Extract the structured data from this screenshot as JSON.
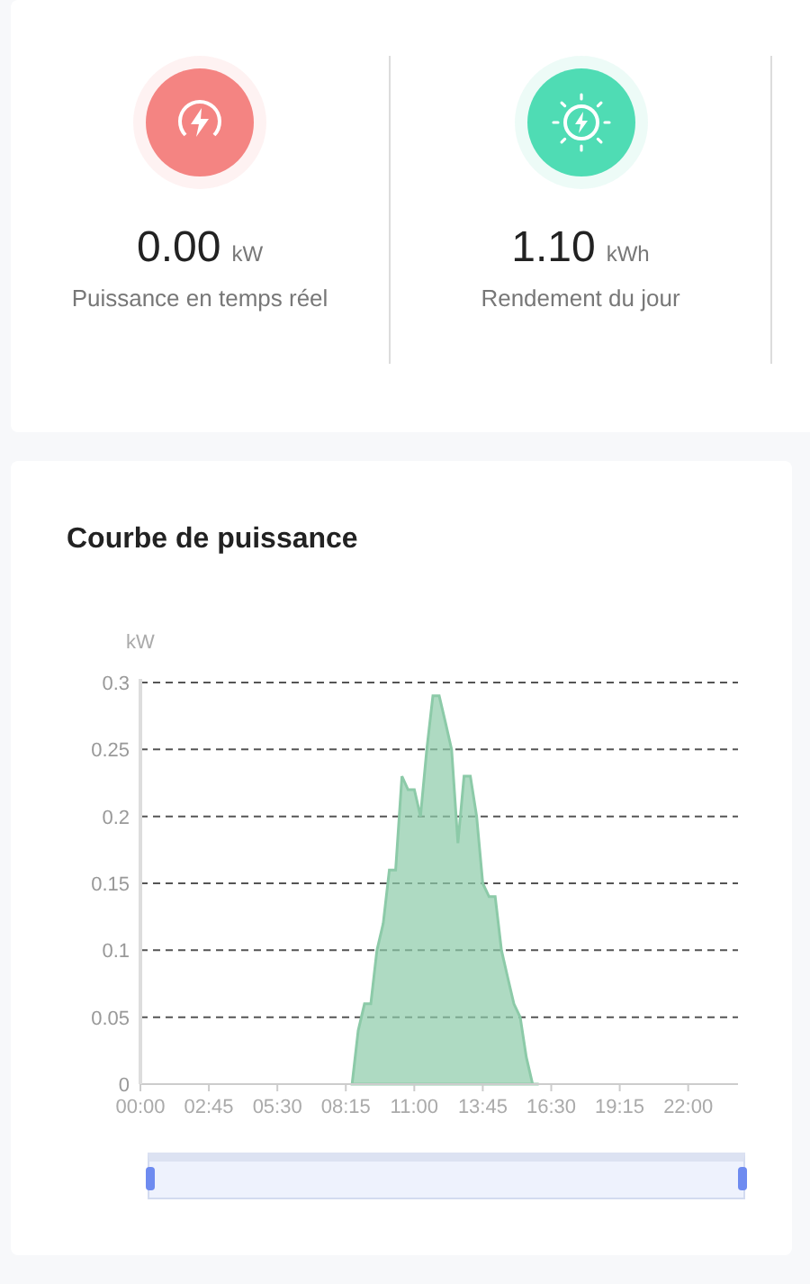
{
  "stats": [
    {
      "kind": "power",
      "color": "#f48482",
      "value": "0.00",
      "unit": "kW",
      "label": "Puissance en temps réel"
    },
    {
      "kind": "solar",
      "color": "#4fdcb4",
      "value": "1.10",
      "unit": "kWh",
      "label": "Rendement du jour"
    }
  ],
  "power_curve": {
    "chart_data": {
      "type": "area",
      "title": "Courbe de puissance",
      "ylabel": "kW",
      "x": [
        8.5,
        8.75,
        9,
        9.25,
        9.5,
        9.75,
        10,
        10.25,
        10.5,
        10.75,
        11,
        11.25,
        11.5,
        11.75,
        12,
        12.25,
        12.5,
        12.75,
        13,
        13.25,
        13.5,
        13.75,
        14,
        14.25,
        14.5,
        14.75,
        15,
        15.25,
        15.5,
        15.75,
        16
      ],
      "grid": true,
      "series": [
        {
          "color": "#8ccaa8",
          "values": [
            0,
            0.04,
            0.06,
            0.06,
            0.1,
            0.12,
            0.16,
            0.16,
            0.23,
            0.22,
            0.22,
            0.2,
            0.25,
            0.29,
            0.29,
            0.27,
            0.25,
            0.18,
            0.23,
            0.23,
            0.2,
            0.15,
            0.14,
            0.14,
            0.1,
            0.08,
            0.06,
            0.05,
            0.02,
            0,
            0
          ]
        }
      ],
      "xlim": [
        0,
        24
      ],
      "ylim": [
        0,
        0.3
      ],
      "xticks": [
        {
          "value": 0,
          "label": "00:00"
        },
        {
          "value": 2.75,
          "label": "02:45"
        },
        {
          "value": 5.5,
          "label": "05:30"
        },
        {
          "value": 8.25,
          "label": "08:15"
        },
        {
          "value": 11,
          "label": "11:00"
        },
        {
          "value": 13.75,
          "label": "13:45"
        },
        {
          "value": 16.5,
          "label": "16:30"
        },
        {
          "value": 19.25,
          "label": "19:15"
        },
        {
          "value": 22,
          "label": "22:00"
        }
      ],
      "yticks": [
        {
          "value": 0,
          "label": "0"
        },
        {
          "value": 0.05,
          "label": "0.05"
        },
        {
          "value": 0.1,
          "label": "0.1"
        },
        {
          "value": 0.15,
          "label": "0.15"
        },
        {
          "value": 0.2,
          "label": "0.2"
        },
        {
          "value": 0.25,
          "label": "0.25"
        },
        {
          "value": 0.3,
          "label": "0.3"
        }
      ]
    },
    "zoom_slider": {
      "level": 1
    }
  }
}
